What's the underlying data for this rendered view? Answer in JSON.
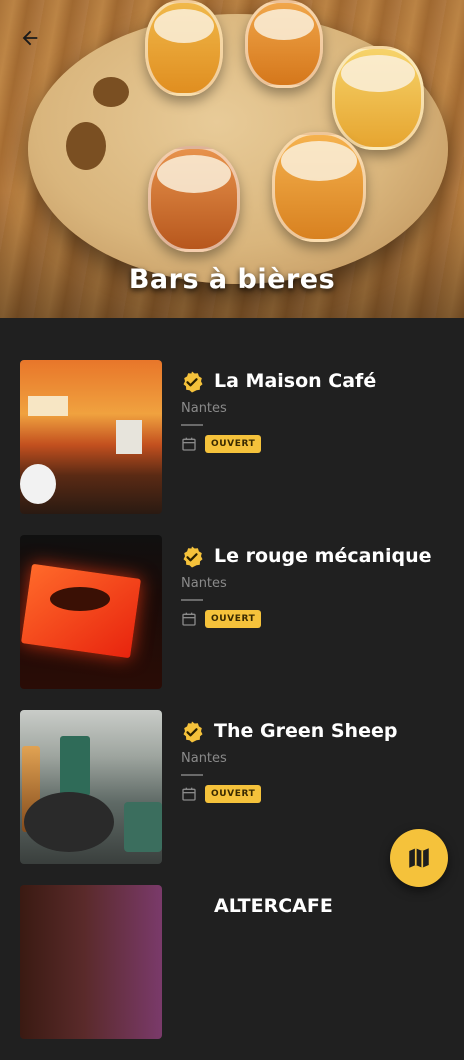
{
  "header": {
    "title": "Bars à bières",
    "back_icon": "arrow-left-icon"
  },
  "bars": [
    {
      "name": "La Maison Café",
      "city": "Nantes",
      "status": "OUVERT"
    },
    {
      "name": "Le rouge mécanique",
      "city": "Nantes",
      "status": "OUVERT"
    },
    {
      "name": "The Green Sheep",
      "city": "Nantes",
      "status": "OUVERT"
    },
    {
      "name": "ALTERCAFE",
      "city": "",
      "status": ""
    }
  ],
  "map_button": {
    "icon": "map-icon"
  },
  "colors": {
    "accent": "#f5c23b",
    "background": "#202020",
    "text_primary": "#ffffff",
    "text_secondary": "#8a8a8a"
  }
}
